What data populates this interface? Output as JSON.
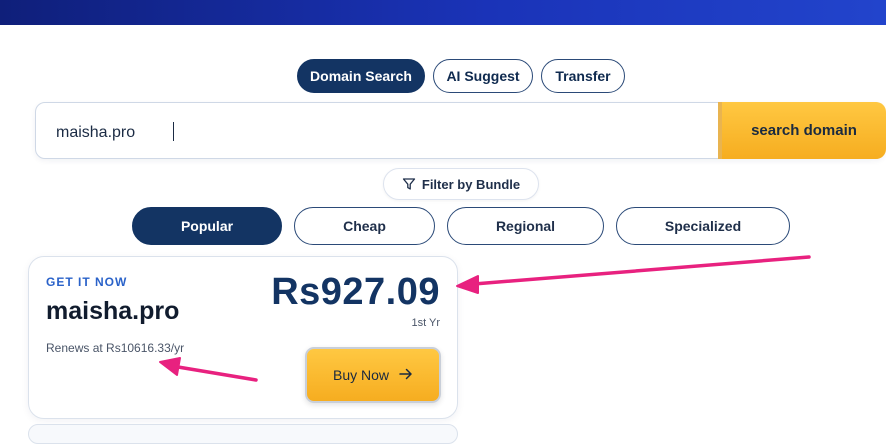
{
  "search": {
    "modes": [
      {
        "label": "Domain Search",
        "active": true
      },
      {
        "label": "AI Suggest",
        "active": false
      },
      {
        "label": "Transfer",
        "active": false
      }
    ],
    "query": "maisha.pro",
    "button_label": "search domain",
    "filter_label": "Filter by Bundle"
  },
  "categories": [
    {
      "label": "Popular",
      "active": true
    },
    {
      "label": "Cheap",
      "active": false
    },
    {
      "label": "Regional",
      "active": false
    },
    {
      "label": "Specialized",
      "active": false
    }
  ],
  "result": {
    "eyebrow": "GET IT NOW",
    "domain": "maisha.pro",
    "renews": "Renews at Rs10616.33/yr",
    "price": "Rs927.09",
    "term": "1st Yr",
    "buy_label": "Buy Now"
  },
  "colors": {
    "primary": "#133463",
    "accent": "#f6ad20",
    "annotation": "#e8217f"
  }
}
